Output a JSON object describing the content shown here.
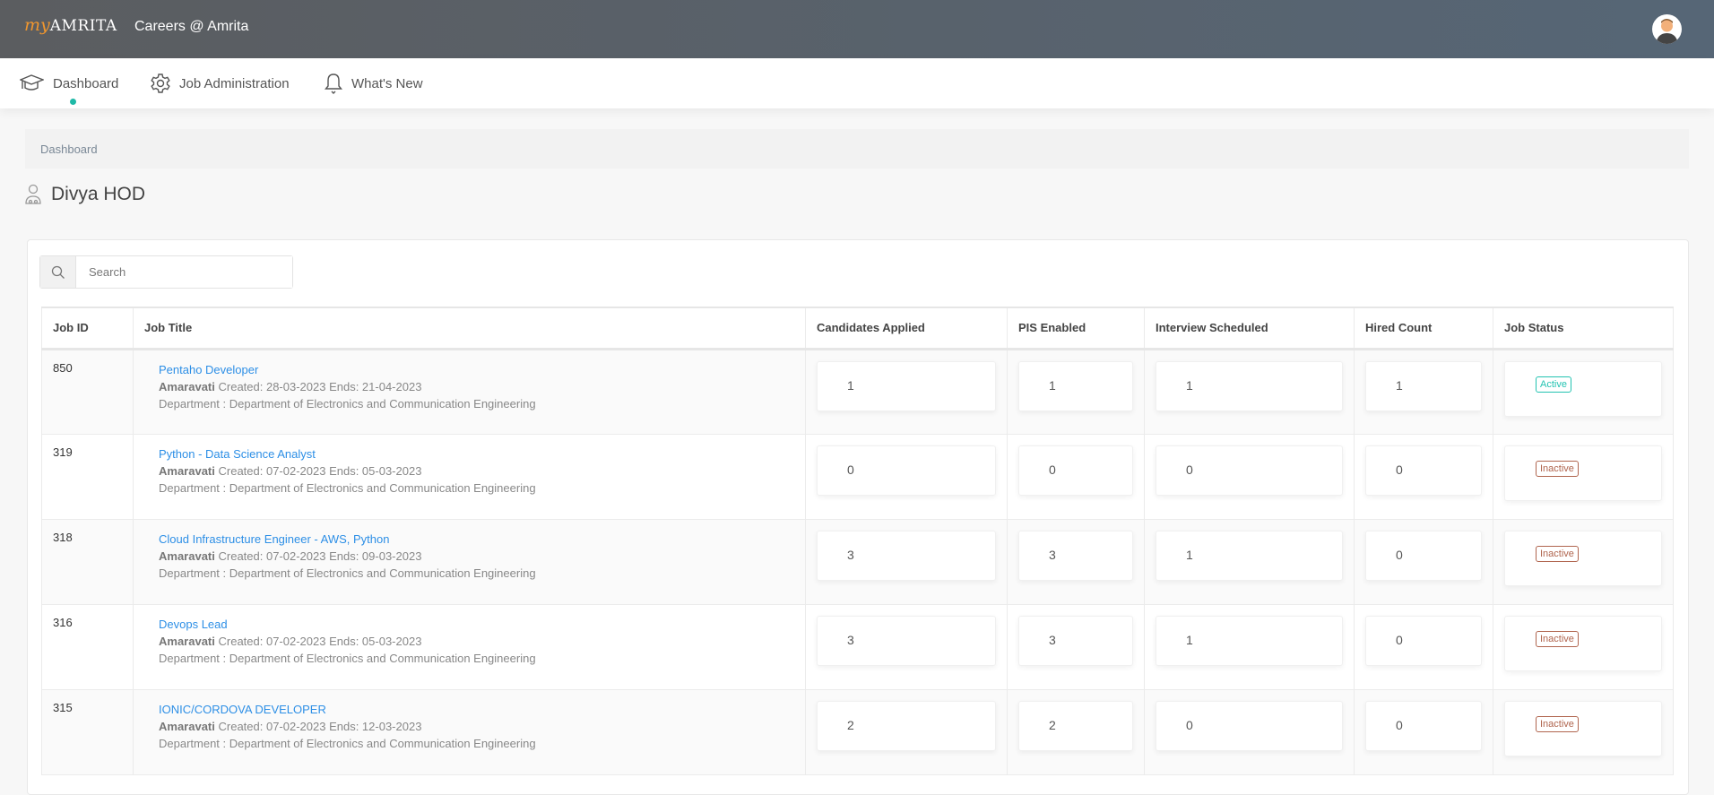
{
  "header": {
    "logo_my": "my",
    "logo_brand": "AMRITA",
    "title": "Careers @ Amrita"
  },
  "nav": {
    "items": [
      {
        "label": "Dashboard"
      },
      {
        "label": "Job Administration"
      },
      {
        "label": "What's New"
      }
    ]
  },
  "breadcrumb": "Dashboard",
  "page_title": "Divya HOD",
  "search": {
    "placeholder": "Search",
    "value": ""
  },
  "table": {
    "columns": [
      "Job ID",
      "Job Title",
      "Candidates Applied",
      "PIS Enabled",
      "Interview Scheduled",
      "Hired Count",
      "Job Status"
    ],
    "rows": [
      {
        "id": "850",
        "title": "Pentaho Developer",
        "location": "Amaravati",
        "dates": "Created: 28-03-2023 Ends: 21-04-2023",
        "department": "Department : Department of Electronics and Communication Engineering",
        "applied": "1",
        "pis": "1",
        "interview": "1",
        "hired": "1",
        "status": "Active"
      },
      {
        "id": "319",
        "title": "Python - Data Science Analyst",
        "location": "Amaravati",
        "dates": "Created: 07-02-2023 Ends: 05-03-2023",
        "department": "Department : Department of Electronics and Communication Engineering",
        "applied": "0",
        "pis": "0",
        "interview": "0",
        "hired": "0",
        "status": "Inactive"
      },
      {
        "id": "318",
        "title": "Cloud Infrastructure Engineer - AWS, Python",
        "location": "Amaravati",
        "dates": "Created: 07-02-2023 Ends: 09-03-2023",
        "department": "Department : Department of Electronics and Communication Engineering",
        "applied": "3",
        "pis": "3",
        "interview": "1",
        "hired": "0",
        "status": "Inactive"
      },
      {
        "id": "316",
        "title": "Devops Lead",
        "location": "Amaravati",
        "dates": "Created: 07-02-2023 Ends: 05-03-2023",
        "department": "Department : Department of Electronics and Communication Engineering",
        "applied": "3",
        "pis": "3",
        "interview": "1",
        "hired": "0",
        "status": "Inactive"
      },
      {
        "id": "315",
        "title": "IONIC/CORDOVA DEVELOPER",
        "location": "Amaravati",
        "dates": "Created: 07-02-2023 Ends: 12-03-2023",
        "department": "Department : Department of Electronics and Communication Engineering",
        "applied": "2",
        "pis": "2",
        "interview": "0",
        "hired": "0",
        "status": "Inactive"
      }
    ]
  },
  "colors": {
    "accent": "#1fb9a7",
    "link": "#2d8fe6",
    "active": "#23c3b1",
    "inactive": "#b0654e"
  }
}
